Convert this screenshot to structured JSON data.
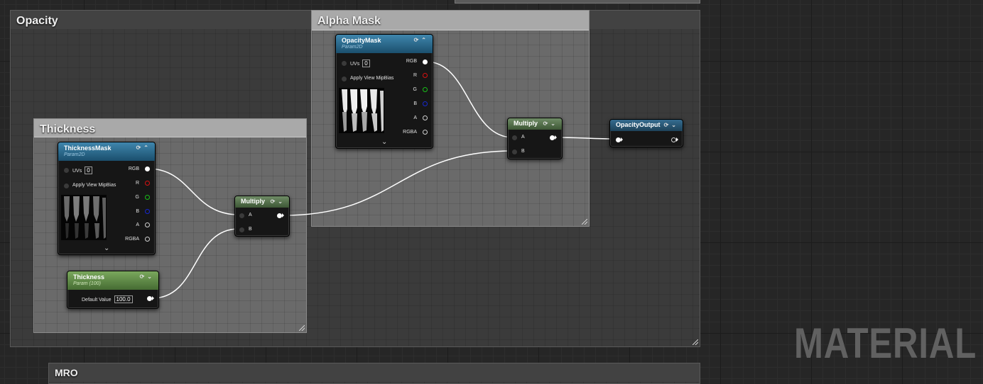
{
  "comments": {
    "opacity": "Opacity",
    "alpha_mask": "Alpha Mask",
    "thickness": "Thickness",
    "mro": "MRO"
  },
  "nodes": {
    "opacity_mask": {
      "title": "OpacityMask",
      "subtitle": "Param2D",
      "uvs_label": "UVs",
      "uvs_value": "0",
      "mip_label": "Apply View MipBias",
      "outputs": [
        "RGB",
        "R",
        "G",
        "B",
        "A",
        "RGBA"
      ]
    },
    "thickness_mask": {
      "title": "ThicknessMask",
      "subtitle": "Param2D",
      "uvs_label": "UVs",
      "uvs_value": "0",
      "mip_label": "Apply View MipBias",
      "outputs": [
        "RGB",
        "R",
        "G",
        "B",
        "A",
        "RGBA"
      ]
    },
    "thickness_param": {
      "title": "Thickness",
      "subtitle": "Param (100)",
      "default_label": "Default Value",
      "default_value": "100.0"
    },
    "multiply_1": {
      "title": "Multiply",
      "input_a": "A",
      "input_b": "B"
    },
    "multiply_2": {
      "title": "Multiply",
      "input_a": "A",
      "input_b": "B"
    },
    "opacity_output": {
      "title": "OpacityOutput"
    }
  },
  "icons": {
    "expand": "chevron-down-icon",
    "options": "circle-arrow-icon",
    "collapse": "chevron-up-icon"
  },
  "watermark": "MATERIAL"
}
